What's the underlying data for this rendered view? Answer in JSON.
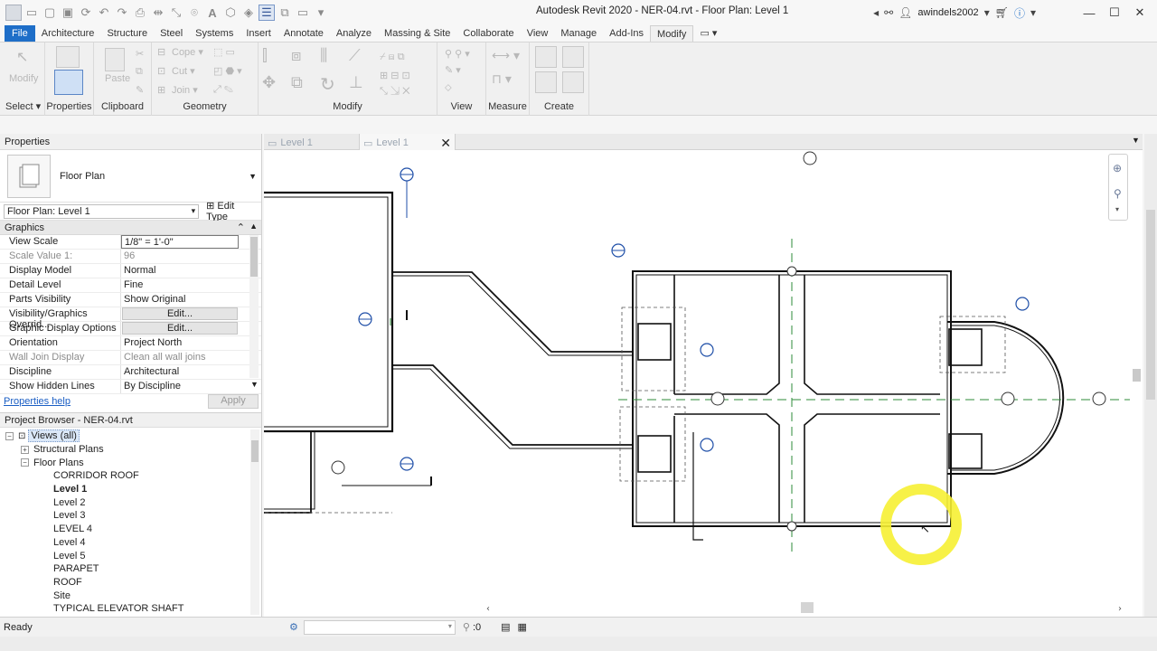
{
  "app": {
    "title": "Autodesk Revit 2020 - NER-04.rvt - Floor Plan: Level 1",
    "username": "awindels2002"
  },
  "menu": [
    "File",
    "Architecture",
    "Structure",
    "Steel",
    "Systems",
    "Insert",
    "Annotate",
    "Analyze",
    "Massing & Site",
    "Collaborate",
    "View",
    "Manage",
    "Add-Ins",
    "Modify"
  ],
  "ribbon": {
    "select": {
      "label": "Select",
      "modify": "Modify"
    },
    "properties_label": "Properties",
    "clipboard": {
      "label": "Clipboard",
      "paste": "Paste"
    },
    "geometry": {
      "label": "Geometry",
      "cope": "Cope",
      "cut": "Cut",
      "join": "Join"
    },
    "modify_label": "Modify",
    "view_label": "View",
    "measure_label": "Measure",
    "create_label": "Create"
  },
  "properties": {
    "title": "Properties",
    "type_name": "Floor Plan",
    "instance_selector": "Floor Plan: Level 1",
    "edit_type": "Edit Type",
    "group": "Graphics",
    "rows": [
      {
        "key": "View Scale",
        "value": "1/8\" = 1'-0\"",
        "muted": false,
        "kind": "box"
      },
      {
        "key": "Scale Value    1:",
        "value": "96",
        "muted": true,
        "kind": "text"
      },
      {
        "key": "Display Model",
        "value": "Normal",
        "muted": false,
        "kind": "text"
      },
      {
        "key": "Detail Level",
        "value": "Fine",
        "muted": false,
        "kind": "text"
      },
      {
        "key": "Parts Visibility",
        "value": "Show Original",
        "muted": false,
        "kind": "text"
      },
      {
        "key": "Visibility/Graphics Overrid...",
        "value": "Edit...",
        "muted": false,
        "kind": "button"
      },
      {
        "key": "Graphic Display Options",
        "value": "Edit...",
        "muted": false,
        "kind": "button"
      },
      {
        "key": "Orientation",
        "value": "Project North",
        "muted": false,
        "kind": "text"
      },
      {
        "key": "Wall Join Display",
        "value": "Clean all wall joins",
        "muted": true,
        "kind": "text"
      },
      {
        "key": "Discipline",
        "value": "Architectural",
        "muted": false,
        "kind": "text"
      },
      {
        "key": "Show Hidden Lines",
        "value": "By Discipline",
        "muted": false,
        "kind": "text"
      }
    ],
    "help_link": "Properties help",
    "apply": "Apply"
  },
  "project_browser": {
    "title": "Project Browser - NER-04.rvt",
    "items": [
      {
        "label": "Views (all)",
        "level": 0,
        "toggle": "-",
        "bold": false,
        "selected": true
      },
      {
        "label": "Structural Plans",
        "level": 1,
        "toggle": "+",
        "bold": false,
        "selected": false
      },
      {
        "label": "Floor Plans",
        "level": 1,
        "toggle": "-",
        "bold": false,
        "selected": false
      },
      {
        "label": "CORRIDOR ROOF",
        "level": 2,
        "toggle": "",
        "bold": false,
        "selected": false
      },
      {
        "label": "Level 1",
        "level": 2,
        "toggle": "",
        "bold": true,
        "selected": false
      },
      {
        "label": "Level 2",
        "level": 2,
        "toggle": "",
        "bold": false,
        "selected": false
      },
      {
        "label": "Level 3",
        "level": 2,
        "toggle": "",
        "bold": false,
        "selected": false
      },
      {
        "label": "LEVEL 4",
        "level": 2,
        "toggle": "",
        "bold": false,
        "selected": false
      },
      {
        "label": "Level 4",
        "level": 2,
        "toggle": "",
        "bold": false,
        "selected": false
      },
      {
        "label": "Level 5",
        "level": 2,
        "toggle": "",
        "bold": false,
        "selected": false
      },
      {
        "label": "PARAPET",
        "level": 2,
        "toggle": "",
        "bold": false,
        "selected": false
      },
      {
        "label": "ROOF",
        "level": 2,
        "toggle": "",
        "bold": false,
        "selected": false
      },
      {
        "label": "Site",
        "level": 2,
        "toggle": "",
        "bold": false,
        "selected": false
      },
      {
        "label": "TYPICAL ELEVATOR SHAFT",
        "level": 2,
        "toggle": "",
        "bold": false,
        "selected": false
      }
    ]
  },
  "view_tabs": [
    {
      "label": "Level 1",
      "active": false,
      "closable": false
    },
    {
      "label": "Level 1",
      "active": true,
      "closable": true
    }
  ],
  "status": {
    "text": "Ready",
    "workset_value": ":0"
  },
  "colors": {
    "accent": "#1e6ec8",
    "grid_blue": "#1f4fa8",
    "highlight": "#f6ef33",
    "green_line": "#2e8b3a"
  }
}
